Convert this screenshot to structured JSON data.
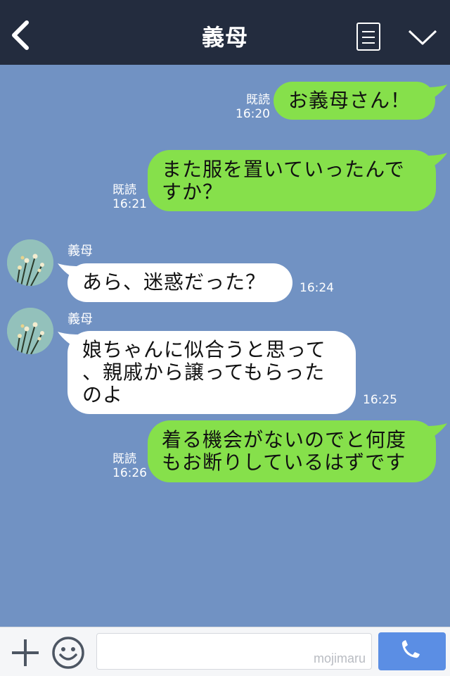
{
  "header": {
    "title": "義母"
  },
  "messages": [
    {
      "side": "me",
      "text": "お義母さん！",
      "read": "既読",
      "time": "16:20"
    },
    {
      "side": "me",
      "text_lines": [
        "また服を置いていったんで",
        "すか？"
      ],
      "read": "既読",
      "time": "16:21"
    },
    {
      "side": "other",
      "sender": "義母",
      "text": "あら、迷惑だった？",
      "time": "16:24"
    },
    {
      "side": "other",
      "sender": "義母",
      "text_lines": [
        "娘ちゃんに似合うと思って",
        "、親戚から譲ってもらった",
        "のよ"
      ],
      "time": "16:25"
    },
    {
      "side": "me",
      "text_lines": [
        "着る機会がないのでと何度",
        "もお断りしているはずです"
      ],
      "read": "既読",
      "time": "16:26"
    }
  ],
  "footer": {
    "watermark": "mojimaru"
  },
  "colors": {
    "header": "#232c3e",
    "background": "#7192c3",
    "my_bubble": "#86e04b",
    "their_bubble": "#ffffff",
    "call_button": "#5b8ee4"
  },
  "icons": {
    "back": "chevron-left-icon",
    "menu": "list-icon",
    "dropdown": "chevron-down-icon",
    "add": "plus-icon",
    "sticker": "smiley-icon",
    "call": "phone-icon"
  }
}
